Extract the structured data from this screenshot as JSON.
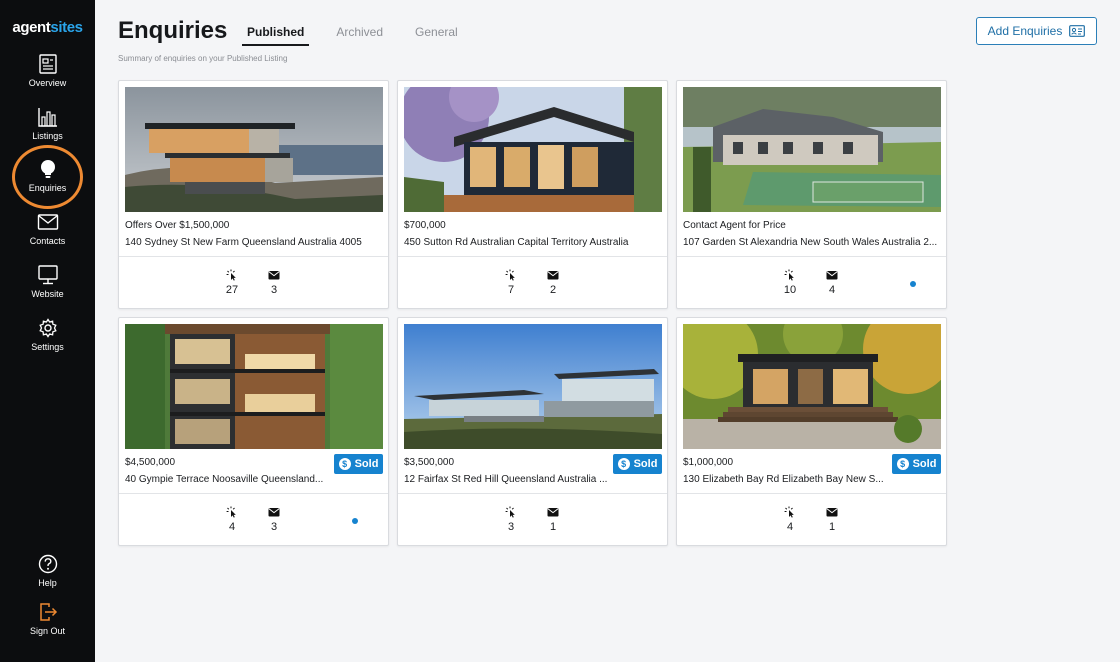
{
  "app": {
    "logo_main": "agent",
    "logo_accent": "sites"
  },
  "sidebar": {
    "items": [
      {
        "label": "Overview",
        "icon": "document-icon"
      },
      {
        "label": "Listings",
        "icon": "chart-icon"
      },
      {
        "label": "Enquiries",
        "icon": "lightbulb-icon",
        "active": true
      },
      {
        "label": "Contacts",
        "icon": "envelope-icon"
      },
      {
        "label": "Website",
        "icon": "monitor-icon"
      },
      {
        "label": "Settings",
        "icon": "gear-icon"
      }
    ],
    "bottom": [
      {
        "label": "Help",
        "icon": "help-icon"
      },
      {
        "label": "Sign Out",
        "icon": "signout-icon"
      }
    ],
    "highlight_color": "#ee8a32"
  },
  "header": {
    "title": "Enquiries",
    "tabs": [
      "Published",
      "Archived",
      "General"
    ],
    "active_tab": "Published",
    "subtitle": "Summary of enquiries on your Published Listing",
    "add_button": "Add Enquiries"
  },
  "listings": [
    {
      "price": "Offers Over $1,500,000",
      "address": "140 Sydney St New Farm Queensland Australia 4005",
      "views": "27",
      "messages": "3",
      "sold": false,
      "unread": false
    },
    {
      "price": "$700,000",
      "address": "450 Sutton Rd Australian Capital Territory Australia",
      "views": "7",
      "messages": "2",
      "sold": false,
      "unread": false
    },
    {
      "price": "Contact Agent for Price",
      "address": "107 Garden St Alexandria New South Wales Australia 2...",
      "views": "10",
      "messages": "4",
      "sold": false,
      "unread": true
    },
    {
      "price": "$4,500,000",
      "address": "40 Gympie Terrace Noosaville Queensland...",
      "views": "4",
      "messages": "3",
      "sold": true,
      "unread": true
    },
    {
      "price": "$3,500,000",
      "address": "12 Fairfax St Red Hill Queensland Australia ...",
      "views": "3",
      "messages": "1",
      "sold": true,
      "unread": false
    },
    {
      "price": "$1,000,000",
      "address": "130 Elizabeth Bay Rd Elizabeth Bay New S...",
      "views": "4",
      "messages": "1",
      "sold": true,
      "unread": false
    }
  ],
  "sold_label": "Sold",
  "sold_coin": "$",
  "colors": {
    "accent": "#1683cf",
    "sidebar_bg": "#0c0d0f"
  }
}
